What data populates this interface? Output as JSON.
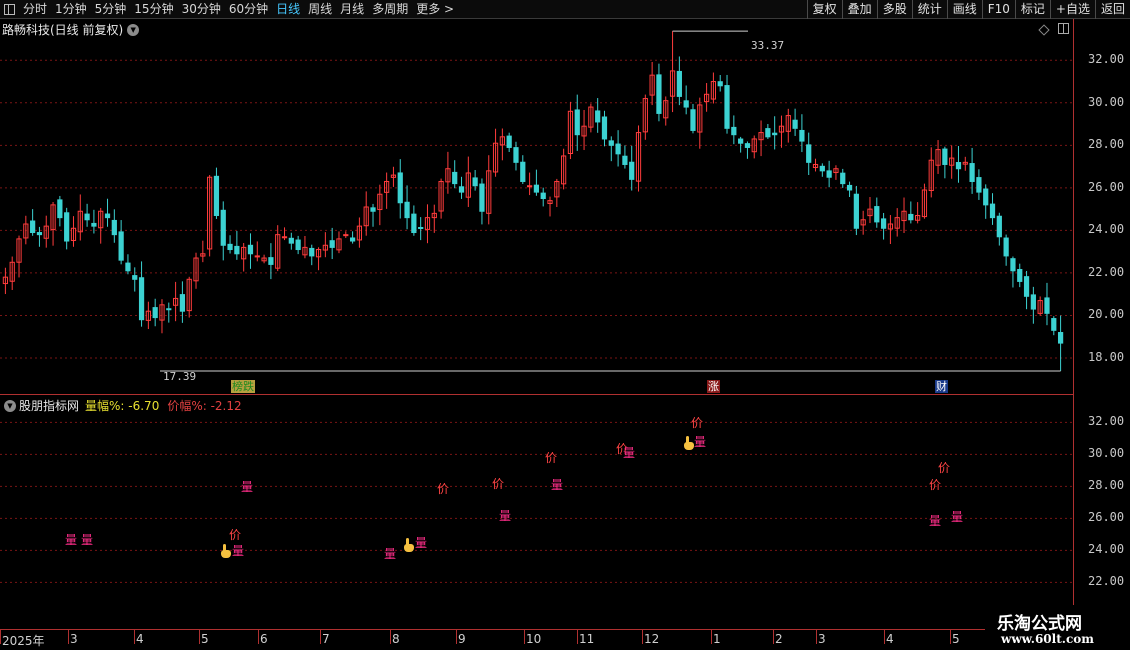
{
  "toolbar": {
    "periods": [
      "分时",
      "1分钟",
      "5分钟",
      "15分钟",
      "30分钟",
      "60分钟",
      "日线",
      "周线",
      "月线",
      "多周期",
      "更多 >"
    ],
    "active_period": "日线",
    "buttons": [
      "复权",
      "叠加",
      "多股",
      "统计",
      "画线",
      "F10",
      "标记",
      "+自选",
      "返回"
    ]
  },
  "main_chart": {
    "title": "路畅科技(日线 前复权)",
    "price_axis": [
      "32.00",
      "30.00",
      "28.00",
      "26.00",
      "24.00",
      "22.00",
      "20.00",
      "18.00"
    ],
    "high_label": "33.37",
    "low_label": "17.39",
    "event_tags": [
      "榜跌",
      "涨",
      "财"
    ]
  },
  "indicator": {
    "name": "股朋指标网",
    "vol_label": "量幅%: -6.70",
    "price_label": "价幅%: -2.12",
    "axis": [
      "32.00",
      "30.00",
      "28.00",
      "26.00",
      "24.00",
      "22.00"
    ],
    "price_mark": "价",
    "vol_mark": "量"
  },
  "date_axis": [
    "2025年",
    "3",
    "4",
    "5",
    "6",
    "7",
    "8",
    "9",
    "10",
    "11",
    "12",
    "1",
    "2",
    "3",
    "4",
    "5"
  ],
  "watermark": {
    "title": "乐淘公式网",
    "url": "www.60lt.com"
  },
  "colors": {
    "up": "#ff3c3c",
    "down": "#3cd2d2",
    "grid": "#7a1515",
    "active": "#46c8ff"
  },
  "chart_data": {
    "type": "candlestick",
    "ylim": [
      16.4,
      33.8
    ],
    "close": [
      21.8,
      22.5,
      23.6,
      24.3,
      23.9,
      23.8,
      24.2,
      25.2,
      24.6,
      23.5,
      24.1,
      24.9,
      24.5,
      24.2,
      24.9,
      24.6,
      23.8,
      22.6,
      22.1,
      21.7,
      19.8,
      20.2,
      19.9,
      20.5,
      20.3,
      20.8,
      20.2,
      21.7,
      22.7,
      22.9,
      26.5,
      24.7,
      23.3,
      23.1,
      22.9,
      23.2,
      22.9,
      22.8,
      22.7,
      22.4,
      23.8,
      23.7,
      23.4,
      23.1,
      23.2,
      22.8,
      23.1,
      23.3,
      23.2,
      23.6,
      23.8,
      23.5,
      24.2,
      25.1,
      24.9,
      25.7,
      26.3,
      26.6,
      25.3,
      24.6,
      23.9,
      24.1,
      24.6,
      24.8,
      26.3,
      26.9,
      26.2,
      25.8,
      26.7,
      26.1,
      24.9,
      26.8,
      28.1,
      28.4,
      27.9,
      27.2,
      26.3,
      26.1,
      25.8,
      25.5,
      25.4,
      26.3,
      27.5,
      29.6,
      28.5,
      28.9,
      29.8,
      29.1,
      28.3,
      28.0,
      27.6,
      27.1,
      26.4,
      28.6,
      30.2,
      31.3,
      29.5,
      30.1,
      31.5,
      30.3,
      29.8,
      28.7,
      29.9,
      30.4,
      31.0,
      30.8,
      28.8,
      28.5,
      28.1,
      27.9,
      28.3,
      28.6,
      28.4,
      28.5,
      28.9,
      29.4,
      28.8,
      28.2,
      27.2,
      27.1,
      26.8,
      26.5,
      26.9,
      26.2,
      25.9,
      24.1,
      24.5,
      25.0,
      24.4,
      24.1,
      24.3,
      24.6,
      24.9,
      24.5,
      24.7,
      25.9,
      27.3,
      27.8,
      27.1,
      27.4,
      26.9,
      27.2,
      26.3,
      25.8,
      25.2,
      24.6,
      23.7,
      22.8,
      22.1,
      21.6,
      20.9,
      20.3,
      20.7,
      20.1,
      19.3,
      18.7
    ],
    "high_value": 33.37,
    "low_value": 17.39,
    "indicator_price_marks": [
      [
        229,
        24.9
      ],
      [
        437,
        27.8
      ],
      [
        492,
        28.1
      ],
      [
        545,
        29.7
      ],
      [
        616,
        30.3
      ],
      [
        691,
        31.9
      ],
      [
        929,
        28.0
      ],
      [
        938,
        29.1
      ]
    ],
    "indicator_vol_marks": [
      [
        65,
        24.6
      ],
      [
        81,
        24.6
      ],
      [
        232,
        23.9
      ],
      [
        241,
        27.9
      ],
      [
        384,
        23.7
      ],
      [
        415,
        24.4
      ],
      [
        499,
        26.1
      ],
      [
        551,
        28.0
      ],
      [
        623,
        30.0
      ],
      [
        694,
        30.7
      ],
      [
        929,
        25.8
      ],
      [
        951,
        26.0
      ]
    ]
  }
}
